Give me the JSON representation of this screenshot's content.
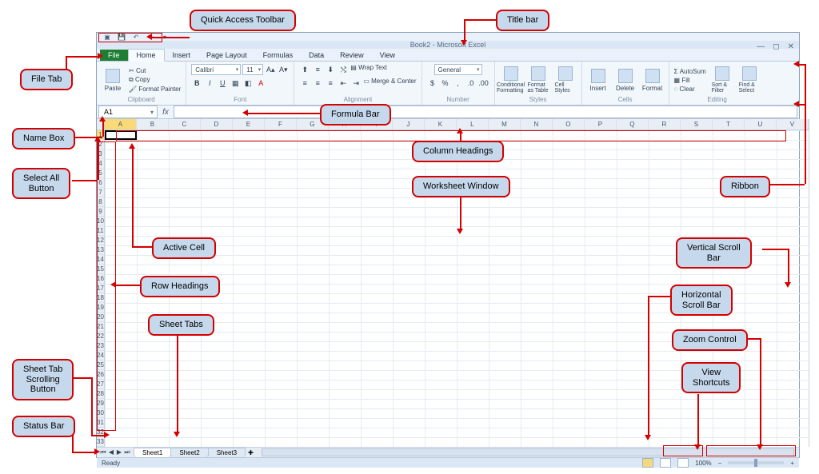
{
  "title": "Book2 - Microsoft Excel",
  "qat_tooltip": "Quick Access Toolbar",
  "tabs": {
    "file": "File",
    "home": "Home",
    "insert": "Insert",
    "pagelayout": "Page Layout",
    "formulas": "Formulas",
    "data": "Data",
    "review": "Review",
    "view": "View"
  },
  "ribbon": {
    "clipboard": {
      "label": "Clipboard",
      "paste": "Paste",
      "cut": "Cut",
      "copy": "Copy",
      "painter": "Format Painter"
    },
    "font": {
      "label": "Font",
      "name": "Calibri",
      "size": "11"
    },
    "alignment": {
      "label": "Alignment",
      "wrap": "Wrap Text",
      "merge": "Merge & Center"
    },
    "number": {
      "label": "Number",
      "fmt": "General"
    },
    "styles": {
      "label": "Styles",
      "cond": "Conditional Formatting",
      "table": "Format as Table",
      "cell": "Cell Styles"
    },
    "cells": {
      "label": "Cells",
      "insert": "Insert",
      "delete": "Delete",
      "format": "Format"
    },
    "editing": {
      "label": "Editing",
      "autosum": "AutoSum",
      "fill": "Fill",
      "clear": "Clear",
      "sort": "Sort & Filter",
      "find": "Find & Select"
    }
  },
  "namebox": "A1",
  "fx": "fx",
  "columns": [
    "A",
    "B",
    "C",
    "D",
    "E",
    "F",
    "G",
    "H",
    "I",
    "J",
    "K",
    "L",
    "M",
    "N",
    "O",
    "P",
    "Q",
    "R",
    "S",
    "T",
    "U",
    "V"
  ],
  "rows": [
    "1",
    "2",
    "3",
    "4",
    "5",
    "6",
    "7",
    "8",
    "9",
    "10",
    "11",
    "12",
    "13",
    "14",
    "15",
    "16",
    "17",
    "18",
    "19",
    "20",
    "21",
    "22",
    "23",
    "24",
    "25",
    "26",
    "27",
    "28",
    "29",
    "30",
    "31",
    "32",
    "33"
  ],
  "sheets": {
    "s1": "Sheet1",
    "s2": "Sheet2",
    "s3": "Sheet3"
  },
  "status": {
    "ready": "Ready",
    "zoom": "100%"
  },
  "callouts": {
    "qat": "Quick Access Toolbar",
    "titlebar": "Title bar",
    "filetab": "File Tab",
    "formulabar": "Formula Bar",
    "namebox": "Name Box",
    "selectall": "Select All\nButton",
    "colhead": "Column Headings",
    "wswin": "Worksheet Window",
    "ribbon": "Ribbon",
    "activecell": "Active Cell",
    "rowhead": "Row Headings",
    "sheettabs": "Sheet Tabs",
    "vscroll": "Vertical Scroll\nBar",
    "hscroll": "Horizontal\nScroll Bar",
    "zoom": "Zoom Control",
    "viewsc": "View\nShortcuts",
    "sheetnav": "Sheet Tab\nScrolling\nButton",
    "statusbar": "Status Bar"
  }
}
